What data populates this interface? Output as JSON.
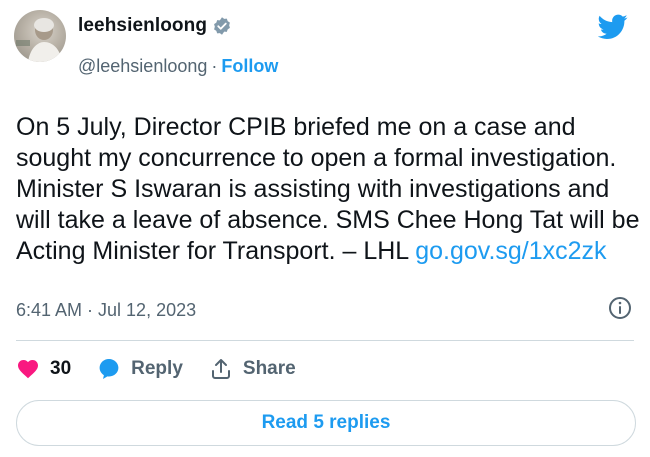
{
  "user": {
    "display_name": "leehsienloong",
    "handle": "@leehsienloong",
    "separator": "·",
    "follow_label": "Follow"
  },
  "tweet": {
    "text": "On 5 July, Director CPIB briefed me on a case and sought my concurrence to open a formal investigation. Minister S Iswaran is assisting with investigations and will take a leave of absence. SMS Chee Hong Tat will be Acting Minister for Transport. – LHL ",
    "link": "go.gov.sg/1xc2zk",
    "timestamp": "6:41 AM · Jul 12, 2023"
  },
  "actions": {
    "like_count": "30",
    "reply_label": "Reply",
    "share_label": "Share"
  },
  "read_replies_label": "Read 5 replies",
  "colors": {
    "accent": "#1d9bf0",
    "like": "#f91880",
    "muted": "#536471",
    "text": "#0f1419"
  }
}
